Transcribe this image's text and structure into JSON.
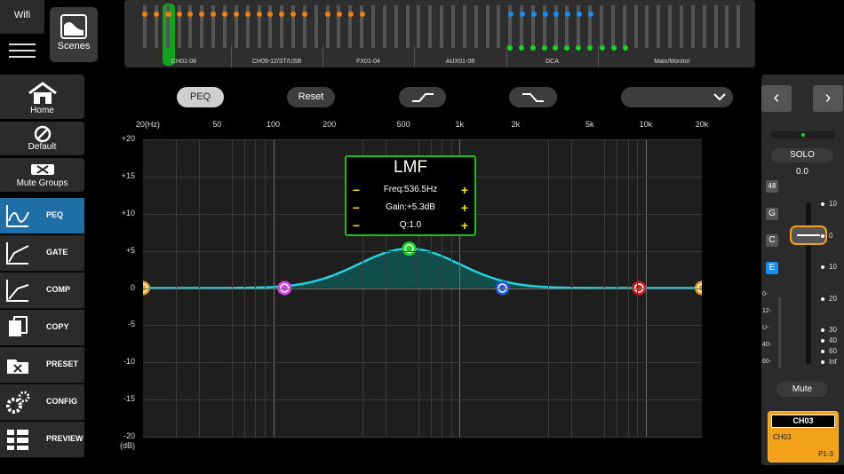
{
  "top": {
    "wifi_label": "Wifi",
    "wifi_sub": "——",
    "scenes_label": "Scenes"
  },
  "strip": {
    "groups": [
      "CH01-08",
      "CH09-12/ST/USB",
      "FX01-04",
      "AUX01-08",
      "DCA",
      "Main/Monitor"
    ],
    "colors": {
      "orange": "#f07f17",
      "green": "#18d51f",
      "blue": "#1a8cf4",
      "selected": "#16a21e"
    }
  },
  "sidebar": {
    "home": "Home",
    "default": "Default",
    "mute_groups": "Mute Groups",
    "nav": [
      "PEQ",
      "GATE",
      "COMP",
      "COPY",
      "PRESET",
      "CONFIG",
      "PREVIEW"
    ]
  },
  "toolbar": {
    "peq": "PEQ",
    "reset": "Reset",
    "dropdown_value": ""
  },
  "graph": {
    "freq_labels": [
      "20(Hz)",
      "50",
      "100",
      "200",
      "500",
      "1k",
      "2k",
      "5k",
      "10k",
      "20k"
    ],
    "gain_labels": [
      "+20",
      "+15",
      "+10",
      "+5",
      "0",
      "-5",
      "-10",
      "-15",
      "-20\n(dB)"
    ],
    "gain_db_unit": "(dB)",
    "curve_color": "#1fd4e0",
    "fill_color": "#0e5f5b"
  },
  "popup": {
    "band": "LMF",
    "freq": "Freq:536.5Hz",
    "gain": "Gain:+5.3dB",
    "q": "Q:1.0",
    "minus": "−",
    "plus": "+"
  },
  "right": {
    "prev": "‹",
    "next": "›",
    "solo": "SOLO",
    "value": "0.0",
    "btn_48": "48",
    "btn_g": "G",
    "btn_c": "C",
    "btn_e": "E",
    "scale": [
      "10",
      "0",
      "10",
      "20",
      "30",
      "40",
      "60",
      "Inf"
    ],
    "meter_labels": [
      "0-",
      "12-",
      "U-",
      "40-",
      "60-"
    ],
    "mute": "Mute",
    "card": {
      "title": "CH03",
      "name": "CH03",
      "patch": "P1-3"
    }
  }
}
